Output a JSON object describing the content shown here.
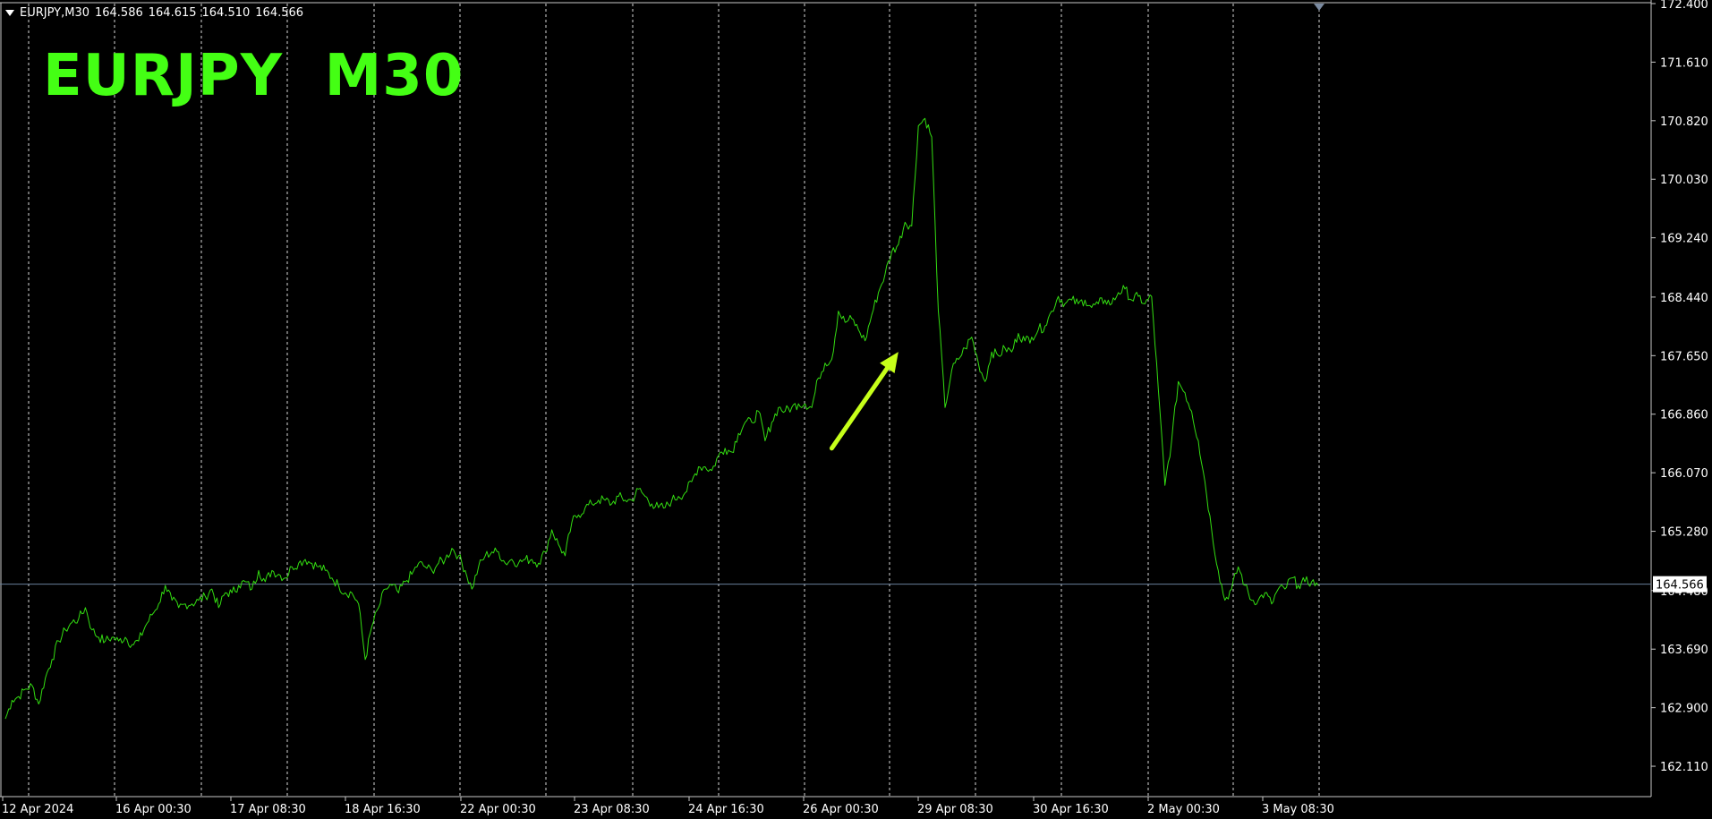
{
  "header": {
    "symbol_timeframe": "EURJPY,M30",
    "open": "164.586",
    "high": "164.615",
    "low": "164.510",
    "close": "164.566"
  },
  "overlay_title": "EURJPY  M30",
  "colors": {
    "background": "#000000",
    "price_line": "#33dd11",
    "grid": "#ffffff",
    "axis": "#c8c8c8",
    "bid_line": "#6a7f9a",
    "title": "#44ff14",
    "arrow": "#c6ff1a",
    "badge_bg": "#ffffff"
  },
  "chart_data": {
    "type": "line",
    "title": "EURJPY  M30",
    "xlabel": "",
    "ylabel": "",
    "ylim": [
      161.7,
      172.4
    ],
    "y_ticks": [
      "172.400",
      "171.610",
      "170.820",
      "170.030",
      "169.240",
      "168.440",
      "167.650",
      "166.860",
      "166.070",
      "165.280",
      "164.480",
      "163.690",
      "162.900",
      "162.110"
    ],
    "x_ticks": [
      "12 Apr 2024",
      "16 Apr 00:30",
      "17 Apr 08:30",
      "18 Apr 16:30",
      "22 Apr 00:30",
      "23 Apr 08:30",
      "24 Apr 16:30",
      "26 Apr 00:30",
      "29 Apr 08:30",
      "30 Apr 16:30",
      "2 May 00:30",
      "3 May 08:30"
    ],
    "x_tick_index": [
      0,
      1,
      2,
      3,
      4,
      5,
      6,
      7,
      8,
      9,
      10,
      11
    ],
    "grid": true,
    "current_price": 164.566,
    "current_price_label": "164.566",
    "series": [
      {
        "values": [
          162.75,
          163.0,
          163.05,
          163.15,
          163.2,
          162.95,
          163.3,
          163.55,
          163.8,
          163.95,
          164.05,
          164.1,
          164.25,
          163.95,
          163.85,
          163.8,
          163.85,
          163.8,
          163.85,
          163.75,
          163.8,
          164.0,
          164.15,
          164.3,
          164.55,
          164.35,
          164.25,
          164.3,
          164.3,
          164.35,
          164.4,
          164.5,
          164.25,
          164.45,
          164.45,
          164.55,
          164.6,
          164.5,
          164.75,
          164.6,
          164.75,
          164.7,
          164.65,
          164.8,
          164.85,
          164.9,
          164.85,
          164.8,
          164.75,
          164.65,
          164.55,
          164.45,
          164.45,
          164.3,
          163.55,
          164.0,
          164.25,
          164.5,
          164.55,
          164.45,
          164.6,
          164.7,
          164.85,
          164.8,
          164.75,
          164.85,
          164.9,
          165.05,
          164.95,
          164.75,
          164.5,
          164.8,
          164.95,
          165.0,
          165.0,
          164.85,
          164.9,
          164.85,
          164.9,
          164.9,
          164.85,
          165.0,
          165.3,
          165.1,
          164.95,
          165.4,
          165.5,
          165.6,
          165.65,
          165.7,
          165.7,
          165.65,
          165.75,
          165.7,
          165.7,
          165.85,
          165.75,
          165.65,
          165.6,
          165.6,
          165.7,
          165.75,
          165.8,
          165.95,
          166.15,
          166.15,
          166.1,
          166.3,
          166.4,
          166.35,
          166.6,
          166.75,
          166.75,
          166.9,
          166.5,
          166.75,
          166.95,
          166.9,
          166.95,
          167.0,
          167.0,
          166.95,
          167.35,
          167.55,
          167.6,
          168.25,
          168.1,
          168.15,
          168.0,
          167.85,
          168.2,
          168.5,
          168.75,
          169.05,
          169.15,
          169.45,
          169.4,
          170.75,
          170.85,
          170.6,
          168.25,
          166.95,
          167.45,
          167.6,
          167.75,
          167.9,
          167.55,
          167.3,
          167.7,
          167.65,
          167.75,
          167.7,
          167.95,
          167.85,
          167.9,
          168.0,
          168.05,
          168.25,
          168.45,
          168.35,
          168.4,
          168.35,
          168.4,
          168.3,
          168.35,
          168.4,
          168.35,
          168.5,
          168.55,
          168.4,
          168.45,
          168.35,
          168.45,
          167.2,
          165.9,
          166.5,
          167.3,
          167.15,
          166.9,
          166.5,
          165.95,
          165.3,
          164.75,
          164.35,
          164.5,
          164.8,
          164.55,
          164.35,
          164.35,
          164.45,
          164.3,
          164.5,
          164.5,
          164.65,
          164.55,
          164.6,
          164.6,
          164.55
        ]
      }
    ],
    "annotations": [
      {
        "type": "arrow",
        "from_index": 124,
        "from_value": 166.4,
        "to_index": 134,
        "to_value": 167.7
      }
    ]
  }
}
